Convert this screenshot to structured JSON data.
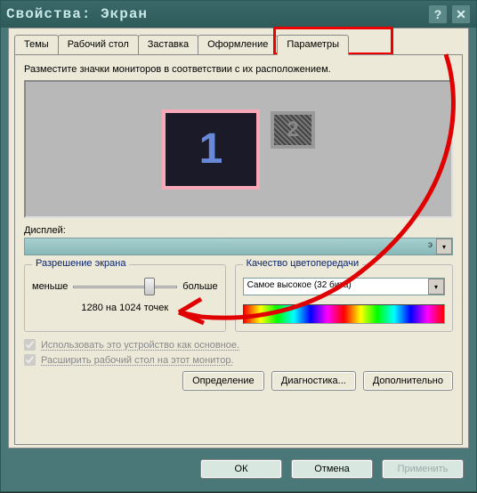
{
  "window": {
    "title": "Свойства: Экран",
    "help_label": "?",
    "close_label": "✕"
  },
  "tabs": [
    {
      "label": "Темы"
    },
    {
      "label": "Рабочий стол"
    },
    {
      "label": "Заставка"
    },
    {
      "label": "Оформление"
    },
    {
      "label": "Параметры",
      "active": true
    }
  ],
  "instruction": "Разместите значки мониторов в соответствии с их расположением.",
  "monitors": {
    "m1": "1",
    "m2": "2"
  },
  "display_label": "Дисплей:",
  "display_value": "э",
  "resolution": {
    "legend": "Разрешение экрана",
    "less": "меньше",
    "more": "больше",
    "value": "1280 на 1024 точек"
  },
  "quality": {
    "legend": "Качество цветопередачи",
    "value": "Самое высокое (32 бита)"
  },
  "checks": {
    "primary": "Использовать это устройство как основное.",
    "extend": "Расширить рабочий стол на этот монитор."
  },
  "buttons": {
    "identify": "Определение",
    "diagnostics": "Диагностика...",
    "advanced": "Дополнительно"
  },
  "dialog_buttons": {
    "ok": "ОК",
    "cancel": "Отмена",
    "apply": "Применить"
  },
  "annotation": {
    "highlight_color": "#e00000",
    "arrow_color": "#e00000"
  }
}
